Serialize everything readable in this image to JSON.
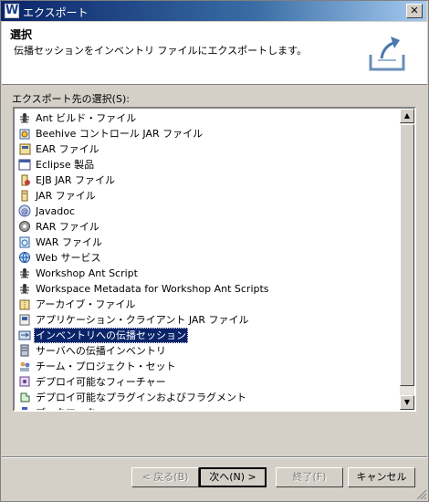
{
  "window": {
    "title": "エクスポート",
    "close_label": "✕"
  },
  "header": {
    "title": "選択",
    "description": "伝播セッションをインベントリ ファイルにエクスポートします。"
  },
  "list": {
    "label": "エクスポート先の選択(S):",
    "items": [
      {
        "label": "Ant ビルド・ファイル",
        "icon": "ant-icon"
      },
      {
        "label": "Beehive コントロール JAR ファイル",
        "icon": "beehive-icon"
      },
      {
        "label": "EAR ファイル",
        "icon": "ear-icon"
      },
      {
        "label": "Eclipse 製品",
        "icon": "eclipse-product-icon"
      },
      {
        "label": "EJB JAR ファイル",
        "icon": "ejb-jar-icon"
      },
      {
        "label": "JAR ファイル",
        "icon": "jar-icon"
      },
      {
        "label": "Javadoc",
        "icon": "javadoc-icon"
      },
      {
        "label": "RAR ファイル",
        "icon": "rar-icon"
      },
      {
        "label": "WAR ファイル",
        "icon": "war-icon"
      },
      {
        "label": "Web サービス",
        "icon": "web-service-icon"
      },
      {
        "label": "Workshop Ant Script",
        "icon": "ant-icon"
      },
      {
        "label": "Workspace Metadata for Workshop Ant Scripts",
        "icon": "ant-icon"
      },
      {
        "label": "アーカイブ・ファイル",
        "icon": "archive-icon"
      },
      {
        "label": "アプリケーション・クライアント JAR ファイル",
        "icon": "app-client-icon"
      },
      {
        "label": "インベントリへの伝播セッション",
        "icon": "propagation-icon",
        "selected": true
      },
      {
        "label": "サーバへの伝播インベントリ",
        "icon": "server-propagation-icon"
      },
      {
        "label": "チーム・プロジェクト・セット",
        "icon": "team-project-icon"
      },
      {
        "label": "デプロイ可能なフィーチャー",
        "icon": "feature-icon"
      },
      {
        "label": "デプロイ可能なプラグインおよびフラグメント",
        "icon": "plugin-icon"
      },
      {
        "label": "ブックマーク",
        "icon": "bookmark-icon"
      }
    ]
  },
  "buttons": {
    "back": "< 戻る(B)",
    "next": "次へ(N) >",
    "finish": "終了(F)",
    "cancel": "キャンセル"
  }
}
